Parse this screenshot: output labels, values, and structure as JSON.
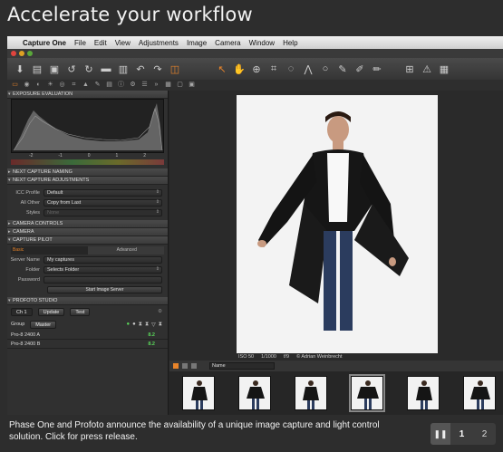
{
  "headline": "Accelerate your workflow",
  "menubar": {
    "apple": "",
    "app": "Capture One",
    "items": [
      "File",
      "Edit",
      "View",
      "Adjustments",
      "Image",
      "Camera",
      "Window",
      "Help"
    ]
  },
  "panel": {
    "exposure_evaluation": "EXPOSURE EVALUATION",
    "histogram_ticks": [
      "-2",
      "-1",
      "0",
      "1",
      "2"
    ],
    "next_capture_naming": "NEXT CAPTURE NAMING",
    "next_capture_adjustments": "NEXT CAPTURE ADJUSTMENTS",
    "icc_profile_label": "ICC Profile",
    "icc_profile_value": "Default",
    "all_other_label": "All Other",
    "all_other_value": "Copy from Last",
    "styles_label": "Styles",
    "styles_value": "None",
    "camera_controls": "CAMERA CONTROLS",
    "camera": "CAMERA",
    "capture_pilot": "CAPTURE PILOT",
    "cp_tab_basic": "Basic",
    "cp_tab_advanced": "Advanced",
    "server_name_label": "Server Name",
    "server_name_value": "My captures",
    "folder_label": "Folder",
    "folder_value": "Selects Folder",
    "password_label": "Password",
    "password_value": "",
    "start_server": "Start Image Server",
    "profoto_studio": "PROFOTO STUDIO",
    "channel": "Ch 1",
    "update": "Update",
    "test": "Test",
    "group_label": "Group",
    "group_value": "Master",
    "units": [
      {
        "name": "Pro-8 2400 A",
        "value": "8.2"
      },
      {
        "name": "Pro-8 2400 B",
        "value": "8.2"
      }
    ]
  },
  "viewer": {
    "meta": [
      "ISO 50",
      "1/1000",
      "f/9",
      "© Adrian Weinbrecht"
    ]
  },
  "filmstrip": {
    "sort_value": "Name"
  },
  "caption": "Phase One and Profoto announce the availability of a unique image capture and light control solution. Click for press release.",
  "pager": {
    "pause": "❚❚",
    "pages": [
      "1",
      "2"
    ],
    "current": 1
  },
  "colors": {
    "accent": "#e8842a",
    "value_green": "#5ad65a"
  }
}
